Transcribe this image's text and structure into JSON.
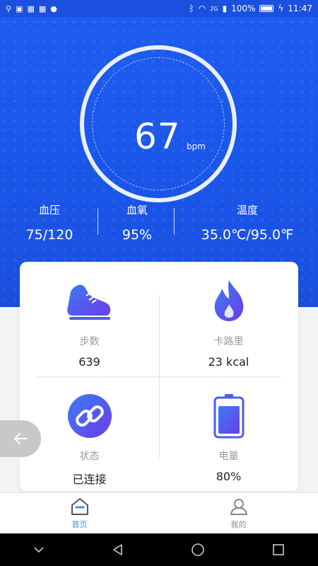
{
  "status_bar": {
    "time": "11:47",
    "battery": "100%",
    "network": "2G"
  },
  "heart_rate": {
    "value": "67",
    "unit": "bpm"
  },
  "vitals": [
    {
      "label": "血压",
      "value": "75/120"
    },
    {
      "label": "血氧",
      "value": "95%"
    },
    {
      "label": "温度",
      "value": "35.0℃/95.0℉"
    }
  ],
  "stats": [
    {
      "label": "步数",
      "value": "639",
      "icon": "shoe-icon"
    },
    {
      "label": "卡路里",
      "value": "23 kcal",
      "icon": "flame-icon"
    },
    {
      "label": "状态",
      "value": "已连接",
      "icon": "link-icon"
    },
    {
      "label": "电量",
      "value": "80%",
      "icon": "battery-icon"
    }
  ],
  "tabs": [
    {
      "label": "首页",
      "icon": "home-icon",
      "active": true
    },
    {
      "label": "我的",
      "icon": "profile-icon",
      "active": false
    }
  ],
  "colors": {
    "primary": "#1a55e8",
    "accent": "#3b8ff0",
    "icon_gradient_start": "#3d7bf5",
    "icon_gradient_end": "#6a3de8"
  }
}
